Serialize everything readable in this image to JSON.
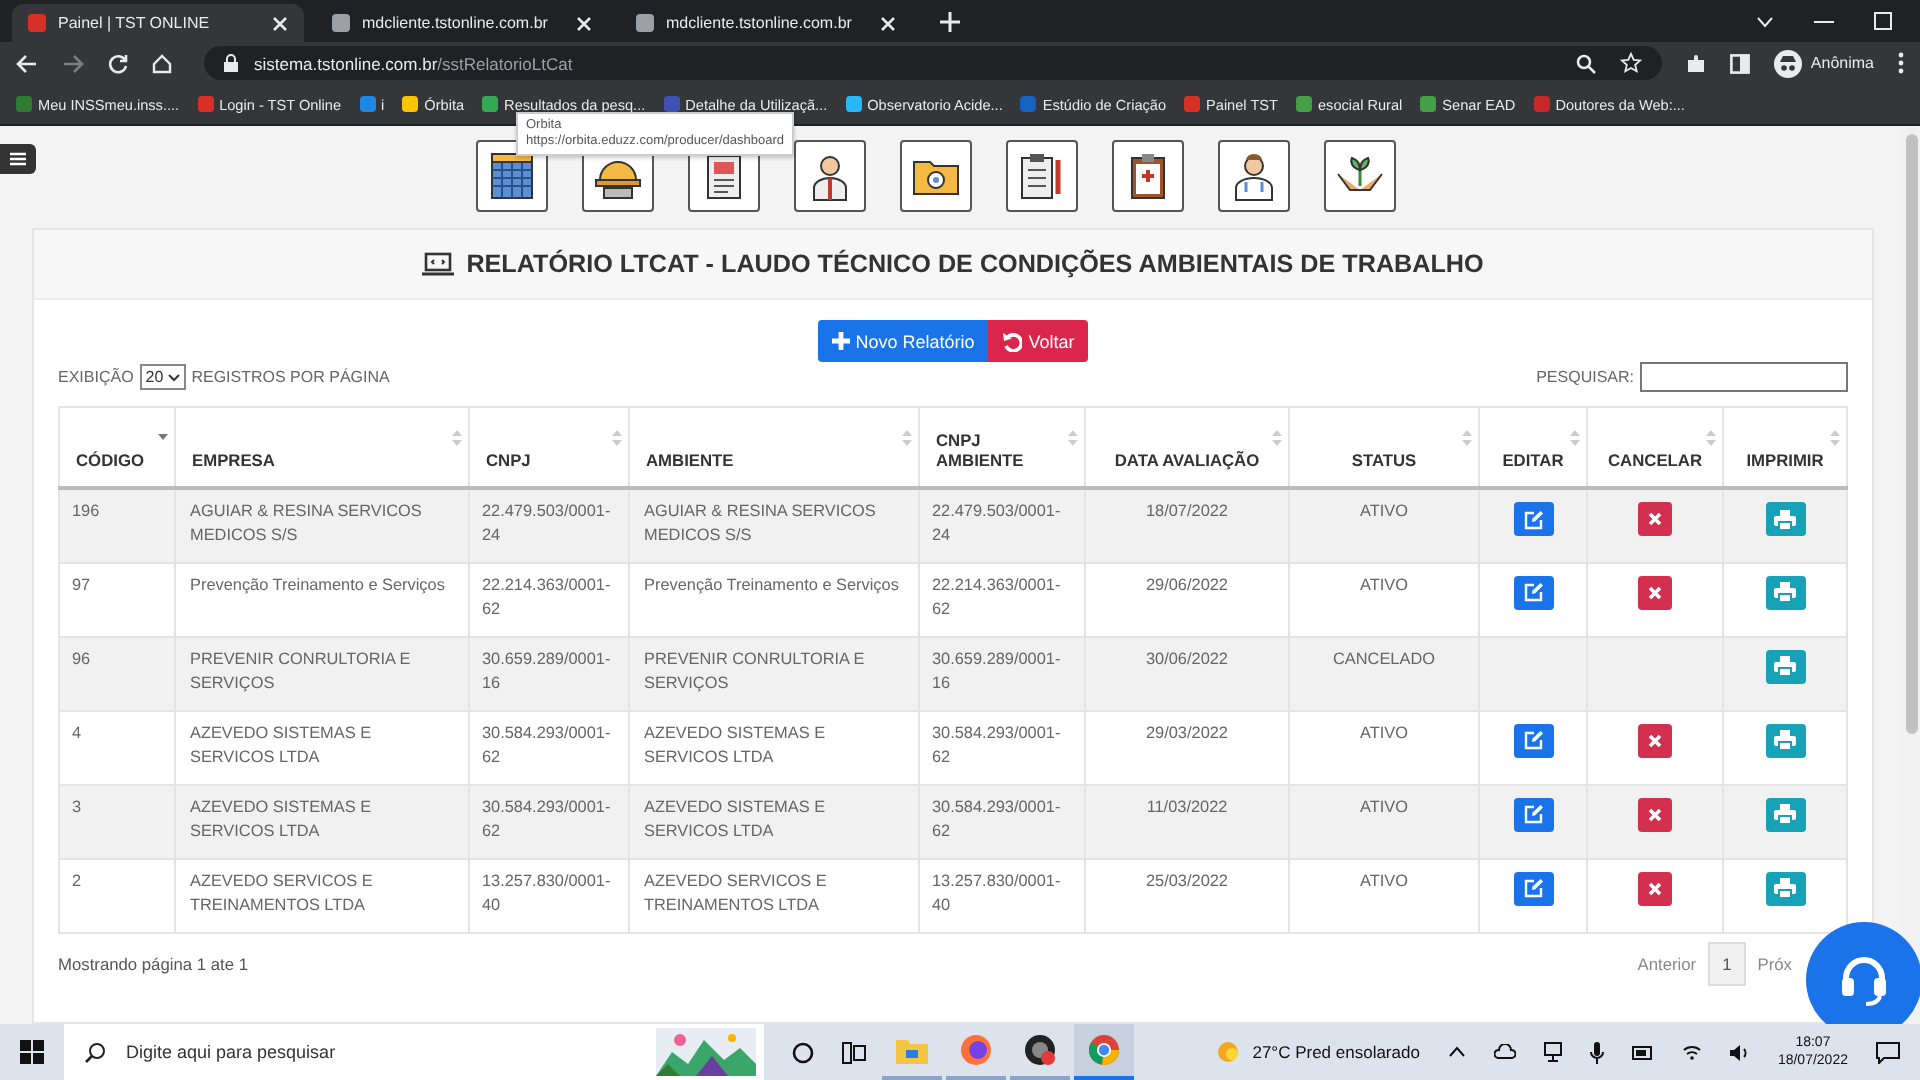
{
  "browser": {
    "tabs": [
      {
        "title": "Painel | TST ONLINE",
        "selected": true,
        "color": "#d93025"
      },
      {
        "title": "mdcliente.tstonline.com.br",
        "selected": false,
        "color": "#9aa0a6"
      },
      {
        "title": "mdcliente.tstonline.com.br",
        "selected": false,
        "color": "#9aa0a6"
      }
    ],
    "address": {
      "host": "sistema.tstonline.com.br",
      "path": "/sstRelatorioLtCat"
    },
    "profile": "Anônima",
    "bookmarks": [
      {
        "label": "Meu INSSmeu.inss....",
        "color": "#2e7d32"
      },
      {
        "label": "Login - TST Online",
        "color": "#d93025"
      },
      {
        "label": "i",
        "color": "#1e88e5"
      },
      {
        "label": "Órbita",
        "color": "#f9c400"
      },
      {
        "label": "Resultados da pesq...",
        "color": "#34a853"
      },
      {
        "label": "Detalhe da Utilizaçã...",
        "color": "#3f51b5"
      },
      {
        "label": "Observatorio Acide...",
        "color": "#29b6f6"
      },
      {
        "label": "Estúdio de Criação",
        "color": "#1565c0"
      },
      {
        "label": "Painel TST",
        "color": "#d93025"
      },
      {
        "label": "esocial Rural",
        "color": "#43a047"
      },
      {
        "label": "Senar EAD",
        "color": "#43a047"
      },
      {
        "label": "Doutores da Web:...",
        "color": "#c62828"
      }
    ],
    "tooltip": {
      "title": "Orbita",
      "url": "https://orbita.eduzz.com/producer/dashboard"
    }
  },
  "page": {
    "title": "RELATÓRIO LTCAT - LAUDO TÉCNICO DE CONDIÇÕES AMBIENTAIS DE TRABALHO",
    "buttons": [
      {
        "label": "Novo Relatório",
        "kind": "new"
      },
      {
        "label": "Voltar",
        "kind": "back"
      }
    ],
    "page_size": {
      "before": "EXIBIÇÃO",
      "value": "20",
      "after": "REGISTROS POR PÁGINA"
    },
    "search": {
      "label": "PESQUISAR:"
    },
    "table": {
      "columns": [
        {
          "label": "CÓDIGO",
          "sorted": true
        },
        {
          "label": "EMPRESA",
          "sorted": false
        },
        {
          "label": "CNPJ",
          "sorted": false
        },
        {
          "label": "AMBIENTE",
          "sorted": false
        },
        {
          "label": "CNPJ AMBIENTE",
          "sorted": false
        },
        {
          "label": "DATA AVALIAÇÃO",
          "sorted": false
        },
        {
          "label": "STATUS",
          "sorted": false
        },
        {
          "label": "EDITAR",
          "sorted": false
        },
        {
          "label": "CANCELAR",
          "sorted": false
        },
        {
          "label": "IMPRIMIR",
          "sorted": false
        }
      ],
      "rows": [
        {
          "code": "196",
          "company": "AGUIAR & RESINA SERVICOS MEDICOS S/S",
          "cnpj": "22.479.503/0001-24",
          "environment": "AGUIAR & RESINA SERVICOS MEDICOS S/S",
          "environment_cnpj": "22.479.503/0001-24",
          "date": "18/07/2022",
          "status": "ATIVO",
          "editable": true,
          "cancellable": true
        },
        {
          "code": "97",
          "company": "Prevenção Treinamento e Serviços",
          "cnpj": "22.214.363/0001-62",
          "environment": "Prevenção Treinamento e Serviços",
          "environment_cnpj": "22.214.363/0001-62",
          "date": "29/06/2022",
          "status": "ATIVO",
          "editable": true,
          "cancellable": true
        },
        {
          "code": "96",
          "company": "PREVENIR CONRULTORIA E SERVIÇOS",
          "cnpj": "30.659.289/0001-16",
          "environment": "PREVENIR CONRULTORIA E SERVIÇOS",
          "environment_cnpj": "30.659.289/0001-16",
          "date": "30/06/2022",
          "status": "CANCELADO",
          "editable": false,
          "cancellable": false
        },
        {
          "code": "4",
          "company": "AZEVEDO SISTEMAS E SERVICOS LTDA",
          "cnpj": "30.584.293/0001-62",
          "environment": "AZEVEDO SISTEMAS E SERVICOS LTDA",
          "environment_cnpj": "30.584.293/0001-62",
          "date": "29/03/2022",
          "status": "ATIVO",
          "editable": true,
          "cancellable": true
        },
        {
          "code": "3",
          "company": "AZEVEDO SISTEMAS E SERVICOS LTDA",
          "cnpj": "30.584.293/0001-62",
          "environment": "AZEVEDO SISTEMAS E SERVICOS LTDA",
          "environment_cnpj": "30.584.293/0001-62",
          "date": "11/03/2022",
          "status": "ATIVO",
          "editable": true,
          "cancellable": true
        },
        {
          "code": "2",
          "company": "AZEVEDO SERVICOS E TREINAMENTOS LTDA",
          "cnpj": "13.257.830/0001-40",
          "environment": "AZEVEDO SERVICOS E TREINAMENTOS LTDA",
          "environment_cnpj": "13.257.830/0001-40",
          "date": "25/03/2022",
          "status": "ATIVO",
          "editable": true,
          "cancellable": true
        }
      ]
    },
    "footer": {
      "info": "Mostrando página 1 ate 1",
      "pagination": [
        {
          "label": "Anterior",
          "selected": false
        },
        {
          "label": "1",
          "selected": true
        },
        {
          "label": "Próx",
          "selected": false
        }
      ]
    }
  },
  "taskbar": {
    "search_placeholder": "Digite aqui para pesquisar",
    "apps": [
      {
        "kind": "explorer",
        "selected": false
      },
      {
        "kind": "firefox",
        "selected": false
      },
      {
        "kind": "obs",
        "selected": false
      },
      {
        "kind": "chrome",
        "selected": true
      }
    ],
    "weather": "27°C  Pred ensolarado",
    "time": "18:07",
    "date": "18/07/2022"
  }
}
